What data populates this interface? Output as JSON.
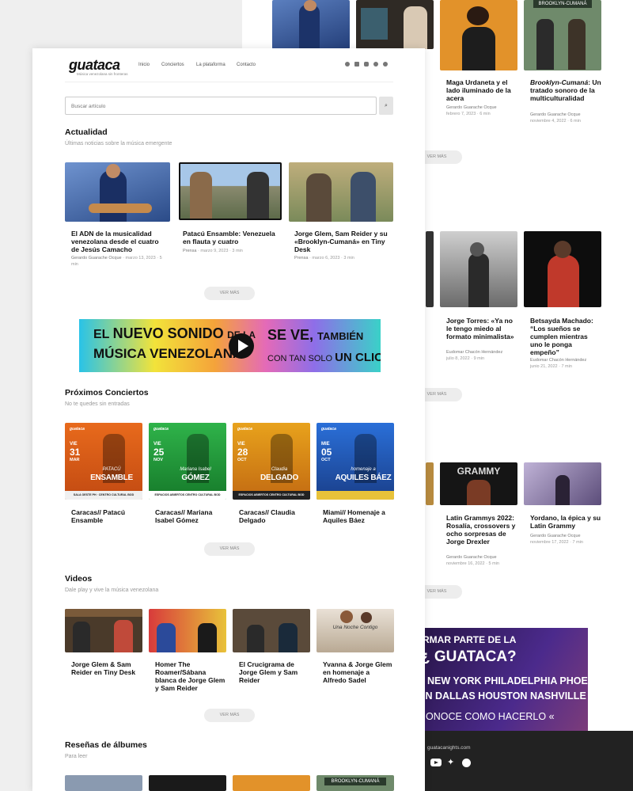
{
  "brand": {
    "logo_text": "guataca",
    "tagline": "Música venezolana sin fronteras"
  },
  "nav": [
    "Inicio",
    "Conciertos",
    "La plataforma",
    "Contacto"
  ],
  "search": {
    "placeholder": "Buscar artículo"
  },
  "sections": {
    "news": {
      "title": "Actualidad",
      "subtitle": "Últimas noticias sobre la música emergente"
    },
    "concerts": {
      "title": "Próximos Conciertos",
      "subtitle": "No te quedes sin entradas"
    },
    "videos": {
      "title": "Videos",
      "subtitle": "Dale play y vive la música venezolana"
    },
    "reviews": {
      "title": "Reseñas de álbumes",
      "subtitle": "Para leer"
    }
  },
  "news_cards": [
    {
      "title": "El ADN de la musicalidad venezolana desde el cuatro de Jesús Camacho",
      "author": "Gerardo Guarache Ocque",
      "date": "marzo 13, 2023",
      "read": "5 min"
    },
    {
      "title": "Patacú Ensamble: Venezuela en flauta y cuatro",
      "author": "Prensa",
      "date": "marzo 9, 2023",
      "read": "3 min"
    },
    {
      "title": "Jorge Glem, Sam Reider y su «Brooklyn-Cumaná» en Tiny Desk",
      "author": "Prensa",
      "date": "marzo 6, 2023",
      "read": "3 min"
    }
  ],
  "see_more": "VER MÁS",
  "banner": {
    "line1a": "EL",
    "line1b": "NUEVO SONIDO",
    "line1c": "DE LA",
    "line2": "MÚSICA VENEZOLANA",
    "line3a": "SE VE,",
    "line3b": "TAMBIÉN",
    "line4a": "CON TAN SOLO",
    "line4b": "UN CLICK"
  },
  "concerts": [
    {
      "title": "Caracas// Patacú Ensamble",
      "day": "VIE",
      "num": "31",
      "month": "MAR",
      "name1": "PATACÚ",
      "name2": "ENSAMBLE",
      "venue": "SALA OESTE PH · CENTRO CULTURAL BOD"
    },
    {
      "title": "Caracas// Mariana Isabel Gómez",
      "day": "VIE",
      "num": "25",
      "month": "NOV",
      "name1": "Mariana Isabel",
      "name2": "GÓMEZ",
      "venue": "ESPACIOS ABIERTOS CENTRO CULTURAL BOD"
    },
    {
      "title": "Caracas// Claudia Delgado",
      "day": "VIE",
      "num": "28",
      "month": "OCT",
      "name1": "Claudia",
      "name2": "DELGADO",
      "venue": "ESPACIOS ABIERTOS CENTRO CULTURAL BOD"
    },
    {
      "title": "Miami// Homenaje a Aquiles Báez",
      "day": "MIE",
      "num": "05",
      "month": "OCT",
      "name1": "homenaje a",
      "name2": "AQUILES BÁEZ",
      "venue": ""
    }
  ],
  "videos": [
    {
      "title": "Jorge Glem & Sam Reider en Tiny Desk"
    },
    {
      "title": "Homer The Roamer/Sábana blanca de Jorge Glem y Sam Reider"
    },
    {
      "title": "El Crucigrama de Jorge Glem y Sam Reider"
    },
    {
      "title": "Yvanna & Jorge Glem en homenaje a Alfredo Sadel",
      "overlay": "Una Noche Contigo"
    }
  ],
  "back": {
    "row1": [
      {
        "title": "Maga Urdaneta y el lado iluminado de la acera",
        "author": "Gerardo Guarache Ocque",
        "date": "febrero 7, 2023",
        "read": "6 min"
      },
      {
        "title_italic": "Brooklyn-Cumaná",
        "title_rest": ": Un tratado sonoro de la multiculturalidad",
        "author": "Gerardo Guarache Ocque",
        "date": "noviembre 4, 2022",
        "read": "6 min",
        "sign": "BROOKLYN-CUMANÁ"
      }
    ],
    "row2": [
      {
        "title": "Jorge Torres: «Ya no le tengo miedo al formato minimalista»",
        "author": "Eudomar Chacón Hernández",
        "date": "julio 8, 2022",
        "read": "9 min"
      },
      {
        "title": "Betsayda Machado: “Los sueños se cumplen mientras uno le ponga empeño”",
        "author": "Eudomar Chacón Hernández",
        "date": "junio 21, 2022",
        "read": "7 min"
      }
    ],
    "row3": [
      {
        "title": "Latin Grammys 2022: Rosalía, crossovers y ocho sorpresas de Jorge Drexler",
        "author": "Gerardo Guarache Ocque",
        "date": "noviembre 16, 2022",
        "read": "5 min",
        "sign": "GRAMMY"
      },
      {
        "title": "Yordano, la épica y su Latin Grammy",
        "author": "Gerardo Guarache Ocque",
        "date": "noviembre 17, 2022",
        "read": "7 min"
      }
    ],
    "promo": {
      "line1": "RMAR PARTE DE LA",
      "line2": "¿ GUATACA?",
      "cities1": [
        "NEW YORK",
        "PHILADELPHIA",
        "PHOENIX"
      ],
      "cities2": [
        "IN",
        "DALLAS",
        "HOUSTON",
        "NASHVILLE"
      ],
      "line4": "ONOCE COMO HACERLO «"
    },
    "footer_email": "guatacanights.com"
  },
  "colors": {
    "accent": "#111111",
    "footer_bg": "#222222",
    "promo_bg": "#3a1f6e"
  }
}
